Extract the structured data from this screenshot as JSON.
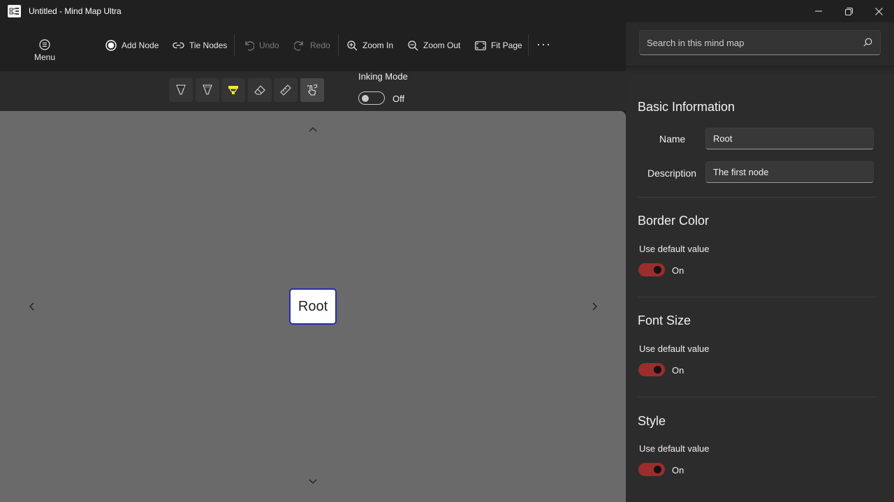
{
  "window": {
    "title": "Untitled - Mind Map Ultra",
    "app_icon": "mind-map-app-icon",
    "controls": [
      "minimize-icon",
      "restore-icon",
      "close-icon"
    ]
  },
  "toolbar": {
    "menu_label": "Menu",
    "add_node": "Add Node",
    "tie_nodes": "Tie Nodes",
    "undo": "Undo",
    "redo": "Redo",
    "zoom_in": "Zoom In",
    "zoom_out": "Zoom Out",
    "fit_page": "Fit Page",
    "more": "···"
  },
  "inking": {
    "tools": [
      "ballpoint-pen-icon",
      "pencil-tip-icon",
      "highlighter-icon",
      "eraser-icon",
      "ruler-icon",
      "touch-writing-icon"
    ],
    "highlighter_color": "#f5e33b",
    "label": "Inking Mode",
    "state_text": "Off",
    "enabled": false
  },
  "canvas": {
    "root_node_label": "Root",
    "node_border_color": "#2929b8"
  },
  "panel": {
    "search_placeholder": "Search in this mind map",
    "basic_info": {
      "title": "Basic Information",
      "name_label": "Name",
      "name_value": "Root",
      "description_label": "Description",
      "description_value": "The first node"
    },
    "border_color": {
      "title": "Border Color",
      "default_label": "Use default value",
      "state_text": "On"
    },
    "font_size": {
      "title": "Font Size",
      "default_label": "Use default value",
      "state_text": "On"
    },
    "style": {
      "title": "Style",
      "default_label": "Use default value",
      "state_text": "On"
    },
    "accent_color": "#9b2d2d"
  }
}
